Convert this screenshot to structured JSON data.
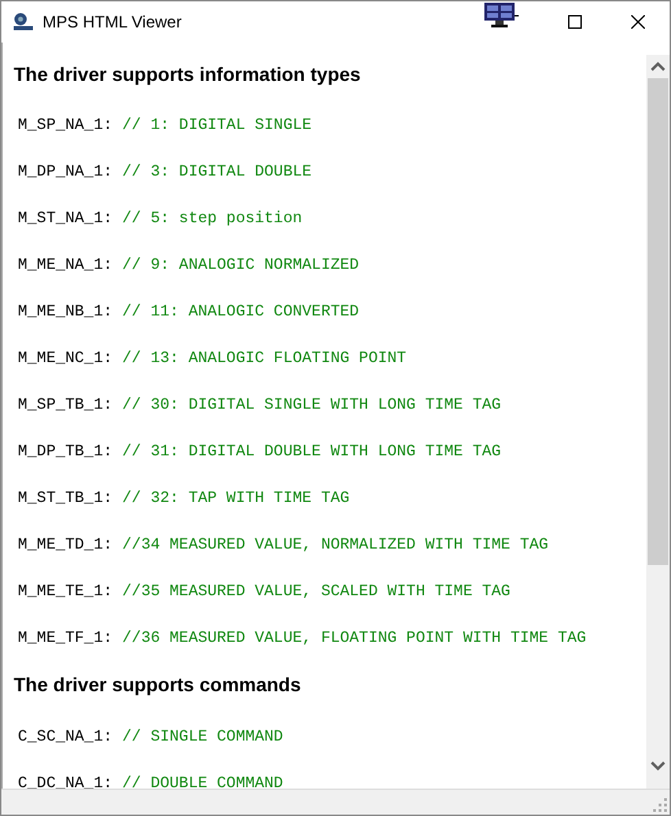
{
  "window": {
    "title": "MPS HTML Viewer"
  },
  "sections": [
    {
      "heading": "The driver supports information types",
      "items": [
        {
          "code": "M_SP_NA_1:",
          "comment": "// 1: DIGITAL SINGLE"
        },
        {
          "code": "M_DP_NA_1:",
          "comment": "// 3: DIGITAL DOUBLE"
        },
        {
          "code": "M_ST_NA_1:",
          "comment": "// 5: step position"
        },
        {
          "code": "M_ME_NA_1:",
          "comment": "// 9: ANALOGIC NORMALIZED"
        },
        {
          "code": "M_ME_NB_1:",
          "comment": "// 11: ANALOGIC CONVERTED"
        },
        {
          "code": "M_ME_NC_1:",
          "comment": "// 13: ANALOGIC FLOATING POINT"
        },
        {
          "code": "M_SP_TB_1:",
          "comment": "// 30: DIGITAL SINGLE WITH LONG TIME TAG"
        },
        {
          "code": "M_DP_TB_1:",
          "comment": "// 31: DIGITAL DOUBLE WITH LONG TIME TAG"
        },
        {
          "code": "M_ST_TB_1:",
          "comment": "// 32: TAP WITH TIME TAG"
        },
        {
          "code": "M_ME_TD_1:",
          "comment": "//34 MEASURED VALUE, NORMALIZED WITH TIME TAG"
        },
        {
          "code": "M_ME_TE_1:",
          "comment": "//35 MEASURED VALUE, SCALED WITH TIME TAG"
        },
        {
          "code": "M_ME_TF_1:",
          "comment": "//36 MEASURED VALUE, FLOATING POINT WITH TIME TAG"
        }
      ]
    },
    {
      "heading": "The driver supports commands",
      "items": [
        {
          "code": "C_SC_NA_1:",
          "comment": "// SINGLE COMMAND"
        },
        {
          "code": "C_DC_NA_1:",
          "comment": "// DOUBLE COMMAND"
        }
      ]
    }
  ]
}
